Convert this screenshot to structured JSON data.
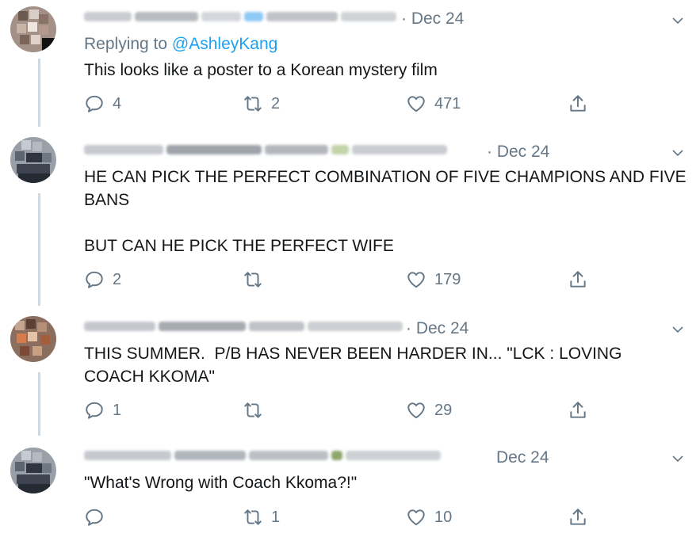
{
  "tweets": [
    {
      "date": "· Dec 24",
      "replying_label": "Replying to",
      "replying_handle": "@AshleyKang",
      "text": "This looks like a poster to a Korean mystery film",
      "replies": "4",
      "retweets": "2",
      "likes": "471"
    },
    {
      "date": "· Dec 24",
      "text": "HE CAN PICK THE PERFECT COMBINATION OF FIVE CHAMPIONS AND FIVE BANS\n\nBUT CAN HE PICK THE PERFECT WIFE",
      "replies": "2",
      "retweets": "",
      "likes": "179"
    },
    {
      "date": "· Dec 24",
      "text": "THIS SUMMER.  P/B HAS NEVER BEEN HARDER IN... \"LCK : LOVING COACH KKOMA\"",
      "replies": "1",
      "retweets": "",
      "likes": "29"
    },
    {
      "date": "Dec 24",
      "text": "\"What's Wrong with Coach Kkoma?!\"",
      "replies": "",
      "retweets": "1",
      "likes": "10"
    }
  ],
  "icons": {
    "reply": "reply-icon",
    "retweet": "retweet-icon",
    "like": "heart-icon",
    "share": "share-icon",
    "caret": "chevron-down-icon"
  },
  "colors": {
    "link": "#1da1f2",
    "secondary": "#657786",
    "text": "#14171a",
    "thread_line": "#d0d8e0"
  }
}
